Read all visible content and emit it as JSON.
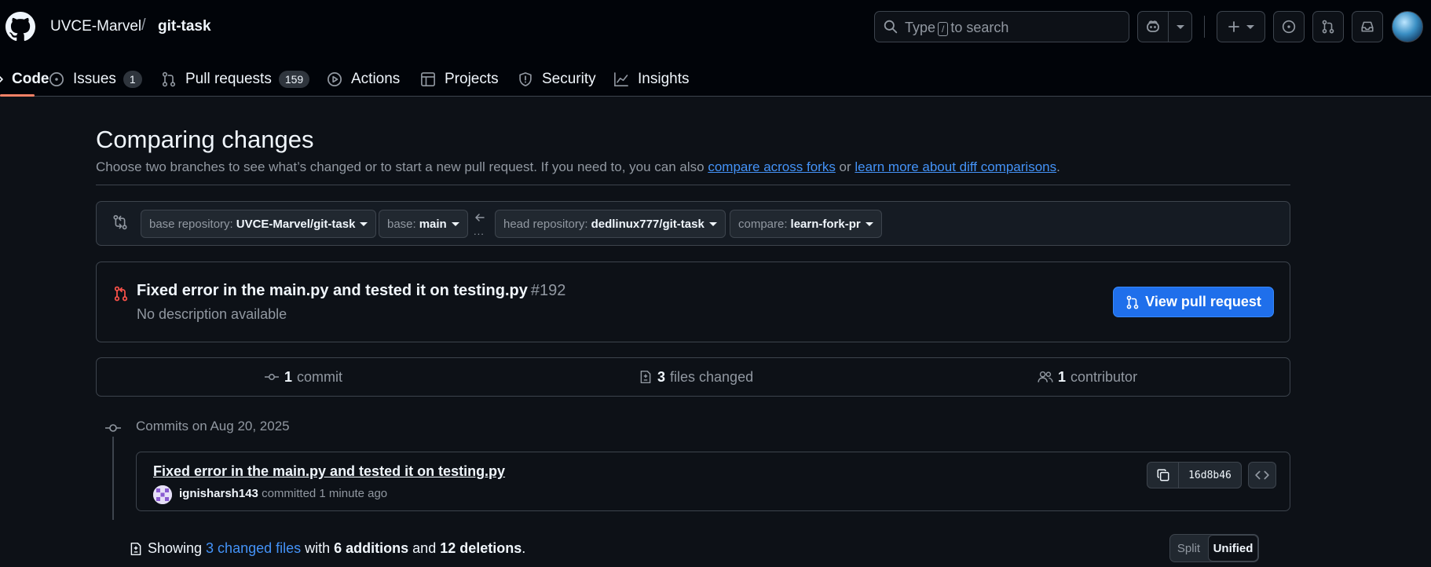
{
  "header": {
    "owner": "UVCE-Marvel",
    "separator": "/",
    "repo": "git-task",
    "search": {
      "prefix": "Type",
      "key": "/",
      "suffix": "to search"
    },
    "icons": [
      "github-logo-icon",
      "search-icon",
      "copilot-icon",
      "chevron-down-icon",
      "plus-icon",
      "issues-icon",
      "pull-requests-icon",
      "inbox-icon"
    ]
  },
  "tabs": [
    {
      "label": "Code",
      "icon": "code-icon",
      "active": true
    },
    {
      "label": "Issues",
      "icon": "issue-opened-icon",
      "count": "1"
    },
    {
      "label": "Pull requests",
      "icon": "git-pull-request-icon",
      "count": "159"
    },
    {
      "label": "Actions",
      "icon": "play-icon"
    },
    {
      "label": "Projects",
      "icon": "table-icon"
    },
    {
      "label": "Security",
      "icon": "shield-icon"
    },
    {
      "label": "Insights",
      "icon": "graph-icon"
    }
  ],
  "compare": {
    "title": "Comparing changes",
    "subtitle_pre": "Choose two branches to see what’s changed or to start a new pull request. If you need to, you can also ",
    "link_forks": "compare across forks",
    "subtitle_mid": " or ",
    "link_learn": "learn more about diff comparisons",
    "subtitle_post": ".",
    "base_repo_label": "base repository:",
    "base_repo_value": "UVCE-Marvel/git-task",
    "base_label": "base:",
    "base_value": "main",
    "head_repo_label": "head repository:",
    "head_repo_value": "dedlinux777/git-task",
    "compare_label": "compare:",
    "compare_value": "learn-fork-pr",
    "ellipsis": "..."
  },
  "pull_request": {
    "title": "Fixed error in the main.py and tested it on testing.py",
    "number": "#192",
    "description": "No description available",
    "button": "View pull request",
    "accent": "#f85149"
  },
  "stats": {
    "commits_count": "1",
    "commits_label": "commit",
    "files_count": "3",
    "files_label": "files changed",
    "contributors_count": "1",
    "contributors_label": "contributor"
  },
  "commits": {
    "heading": "Commits on Aug 20, 2025",
    "items": [
      {
        "message": "Fixed error in the main.py and tested it on testing.py",
        "author": "ignisharsh143",
        "action": "committed",
        "time": "1 minute ago",
        "sha": "16d8b46"
      }
    ]
  },
  "files_summary": {
    "prefix": "Showing",
    "changed_files": "3 changed files",
    "with": "with",
    "additions": "6 additions",
    "and": "and",
    "deletions": "12 deletions",
    "end": "."
  },
  "view_toggle": {
    "split": "Split",
    "unified": "Unified",
    "selected": "Unified"
  },
  "colors": {
    "accent_link": "#4493f8",
    "primary_button": "#1f6feb",
    "active_tab": "#f78166"
  }
}
